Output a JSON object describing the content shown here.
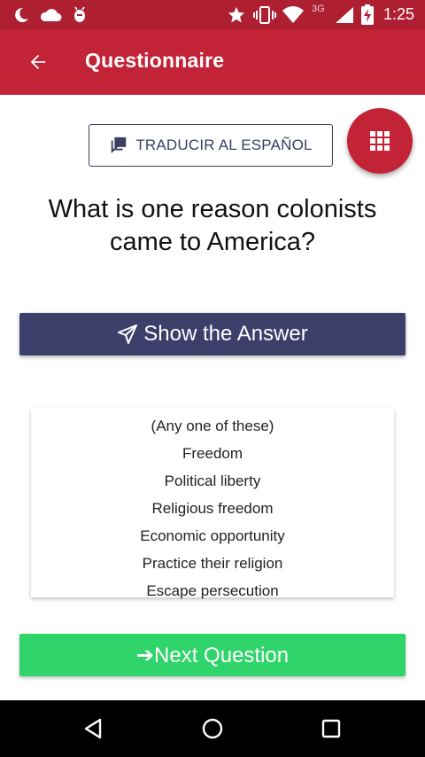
{
  "status_bar": {
    "time": "1:25",
    "network": "3G",
    "icons": [
      "moon-icon",
      "cloud-icon",
      "android-debug-icon",
      "star-icon",
      "vibrate-icon",
      "wifi-icon",
      "signal-icon",
      "battery-charging-icon"
    ]
  },
  "app_bar": {
    "title": "Questionnaire",
    "back_icon": "arrow-left-icon"
  },
  "translate": {
    "label": "TRADUCIR AL ESPAÑOL",
    "icon": "chat-bubbles-icon"
  },
  "fab": {
    "icon": "grid-icon"
  },
  "question": {
    "text": "What is one reason colonists came to America?"
  },
  "show_answer": {
    "label": "Show the Answer",
    "icon": "paper-plane-icon"
  },
  "answers": {
    "lines": [
      "(Any one of these)",
      "Freedom",
      "Political liberty",
      "Religious freedom",
      "Economic opportunity",
      "Practice their religion",
      "Escape persecution"
    ]
  },
  "next_question": {
    "label": "➔Next Question"
  },
  "colors": {
    "status_bar": "#ae1f32",
    "app_bar": "#c32336",
    "primary_navy": "#3d3f6b",
    "success_green": "#2fd46a"
  }
}
